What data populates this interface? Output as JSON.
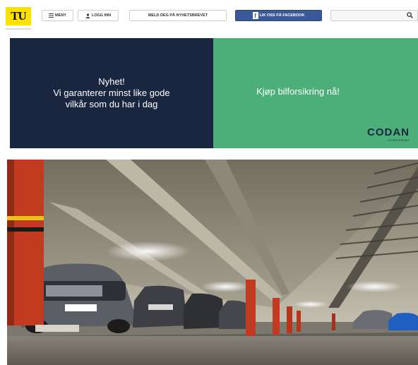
{
  "header": {
    "logo_text": "TU",
    "menu_label": "MENY",
    "login_label": "LOGG INN",
    "newsletter_label": "MELD DEG PÅ NYHETSBREVET",
    "facebook_label": "LIK OSS PÅ FACEBOOK",
    "search_placeholder": ""
  },
  "ad": {
    "headline": "Nyhet!",
    "line1": "Vi garanterer minst like gode",
    "line2": "vilkår som du har i dag",
    "cta": "Kjøp bilforsikring nå!",
    "brand": "CODAN",
    "brand_sub": "FORSIKRING",
    "colors": {
      "left_bg": "#1a2540",
      "right_bg": "#4caf7a"
    }
  },
  "colors": {
    "logo_bg": "#ffe100",
    "facebook": "#3b5998"
  },
  "icons": [
    "menu-icon",
    "user-icon",
    "facebook-icon",
    "search-icon"
  ]
}
